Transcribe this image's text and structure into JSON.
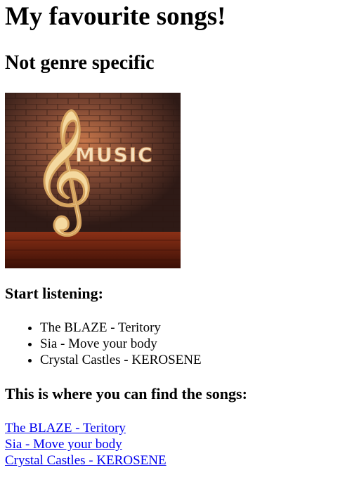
{
  "page": {
    "title": "My favourite songs!",
    "subtitle": "Not genre specific"
  },
  "image": {
    "icon": "treble-clef-icon",
    "text": "MUSIC"
  },
  "listening": {
    "heading": "Start listening:",
    "items": [
      "The BLAZE - Teritory",
      "Sia - Move your body",
      "Crystal Castles - KEROSENE"
    ]
  },
  "find": {
    "heading": "This is where you can find the songs:",
    "links": [
      "The BLAZE - Teritory",
      "Sia - Move your body",
      "Crystal Castles - KEROSENE"
    ]
  },
  "colors": {
    "link": "#0000ee",
    "brick": "#5a3428",
    "stage": "#7a2a18"
  }
}
